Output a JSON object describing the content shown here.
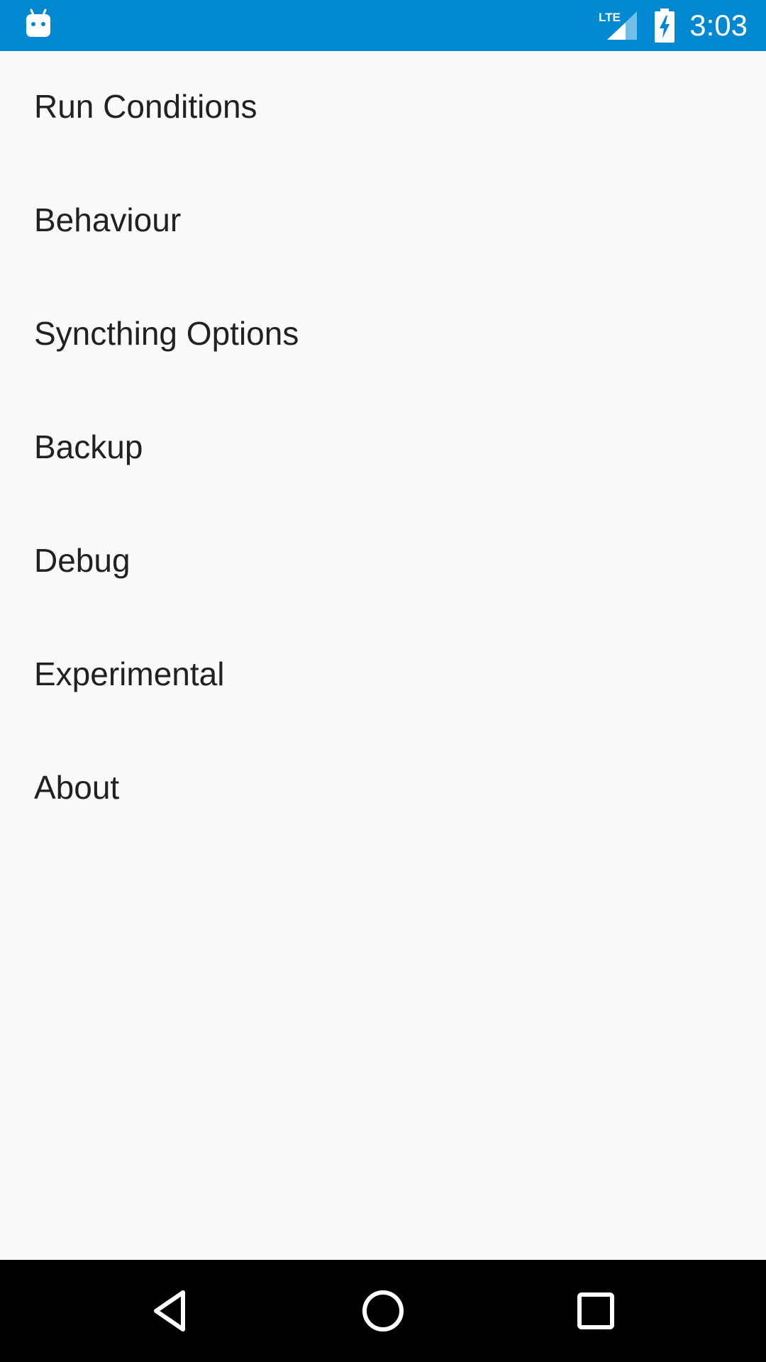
{
  "status_bar": {
    "time": "3:03",
    "network_label": "LTE",
    "app_icon": "android-debug-icon",
    "signal_icon": "cell-signal-icon",
    "battery_icon": "battery-charging-icon",
    "background_color": "#0288d1"
  },
  "preferences": {
    "items": [
      {
        "label": "Run Conditions"
      },
      {
        "label": "Behaviour"
      },
      {
        "label": "Syncthing Options"
      },
      {
        "label": "Backup"
      },
      {
        "label": "Debug"
      },
      {
        "label": "Experimental"
      },
      {
        "label": "About"
      }
    ]
  },
  "nav_bar": {
    "back_icon": "back-triangle-icon",
    "home_icon": "home-circle-icon",
    "recents_icon": "recents-square-icon"
  }
}
